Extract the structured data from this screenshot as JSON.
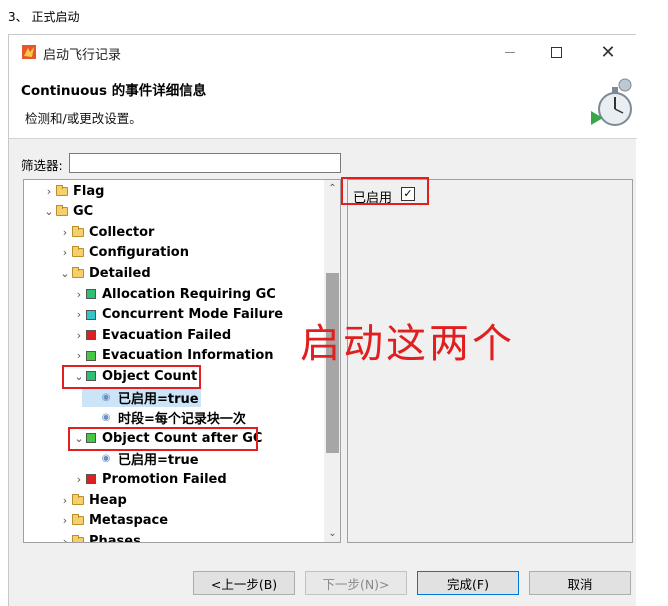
{
  "caption": "3、 正式启动",
  "window": {
    "title": "启动飞行记录"
  },
  "banner": {
    "title": "Continuous 的事件详细信息",
    "subtitle": "检测和/或更改设置。"
  },
  "filter": {
    "label": "筛选器:",
    "value": ""
  },
  "tree": {
    "rows": [
      {
        "label": "Flag",
        "icon": "folder-icon",
        "chevron": "›"
      },
      {
        "label": "GC",
        "icon": "folder-icon",
        "chevron": "⌄"
      },
      {
        "label": "Collector",
        "icon": "folder-icon",
        "chevron": "›"
      },
      {
        "label": "Configuration",
        "icon": "folder-icon",
        "chevron": "›"
      },
      {
        "label": "Detailed",
        "icon": "folder-icon",
        "chevron": "⌄"
      },
      {
        "label": "Allocation Requiring GC",
        "icon": "status-icon",
        "color": "#2fbf71",
        "chevron": "›"
      },
      {
        "label": "Concurrent Mode Failure",
        "icon": "status-icon",
        "color": "#34c6c6",
        "chevron": "›"
      },
      {
        "label": "Evacuation Failed",
        "icon": "status-icon",
        "color": "#e02020",
        "chevron": "›"
      },
      {
        "label": "Evacuation Information",
        "icon": "status-icon",
        "color": "#45c945",
        "chevron": "›"
      },
      {
        "label": "Object Count",
        "icon": "status-icon",
        "color": "#2fbf71",
        "chevron": "⌄"
      },
      {
        "label": "已启用=true",
        "icon": "eye-icon",
        "chevron": ""
      },
      {
        "label": "时段=每个记录块一次",
        "icon": "eye-icon",
        "chevron": ""
      },
      {
        "label": "Object Count after GC",
        "icon": "status-icon",
        "color": "#45c945",
        "chevron": "⌄"
      },
      {
        "label": "已启用=true",
        "icon": "eye-icon",
        "chevron": ""
      },
      {
        "label": "Promotion Failed",
        "icon": "status-icon",
        "color": "#e02020",
        "chevron": "›"
      },
      {
        "label": "Heap",
        "icon": "folder-icon",
        "chevron": "›"
      },
      {
        "label": "Metaspace",
        "icon": "folder-icon",
        "chevron": "›"
      },
      {
        "label": "Phases",
        "icon": "folder-icon",
        "chevron": "›"
      }
    ]
  },
  "right_panel": {
    "enabled_label": "已启用",
    "enabled_checked": true
  },
  "annotation": "启动这两个",
  "buttons": {
    "back": "<上一步(B)",
    "next": "下一步(N)>",
    "finish": "完成(F)",
    "cancel": "取消"
  }
}
